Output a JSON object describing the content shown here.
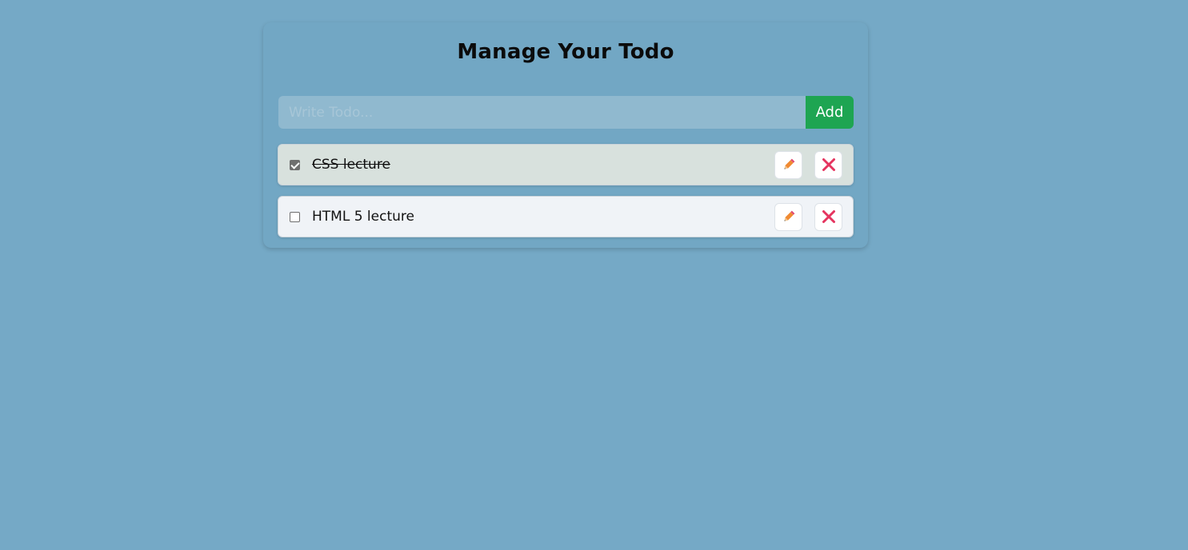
{
  "header": {
    "title": "Manage Your Todo"
  },
  "form": {
    "placeholder": "Write Todo...",
    "value": "",
    "add_label": "Add"
  },
  "todos": [
    {
      "text": "CSS lecture",
      "completed": true
    },
    {
      "text": "HTML 5 lecture",
      "completed": false
    }
  ],
  "icons": {
    "edit": "pencil-icon",
    "delete": "close-icon"
  },
  "colors": {
    "background": "#75a9c6",
    "add_button": "#1ea552",
    "completed_row": "#d8e1dd",
    "pending_row": "#f0f3f7",
    "pencil": "#f08a32",
    "delete_x": "#e5345f"
  }
}
